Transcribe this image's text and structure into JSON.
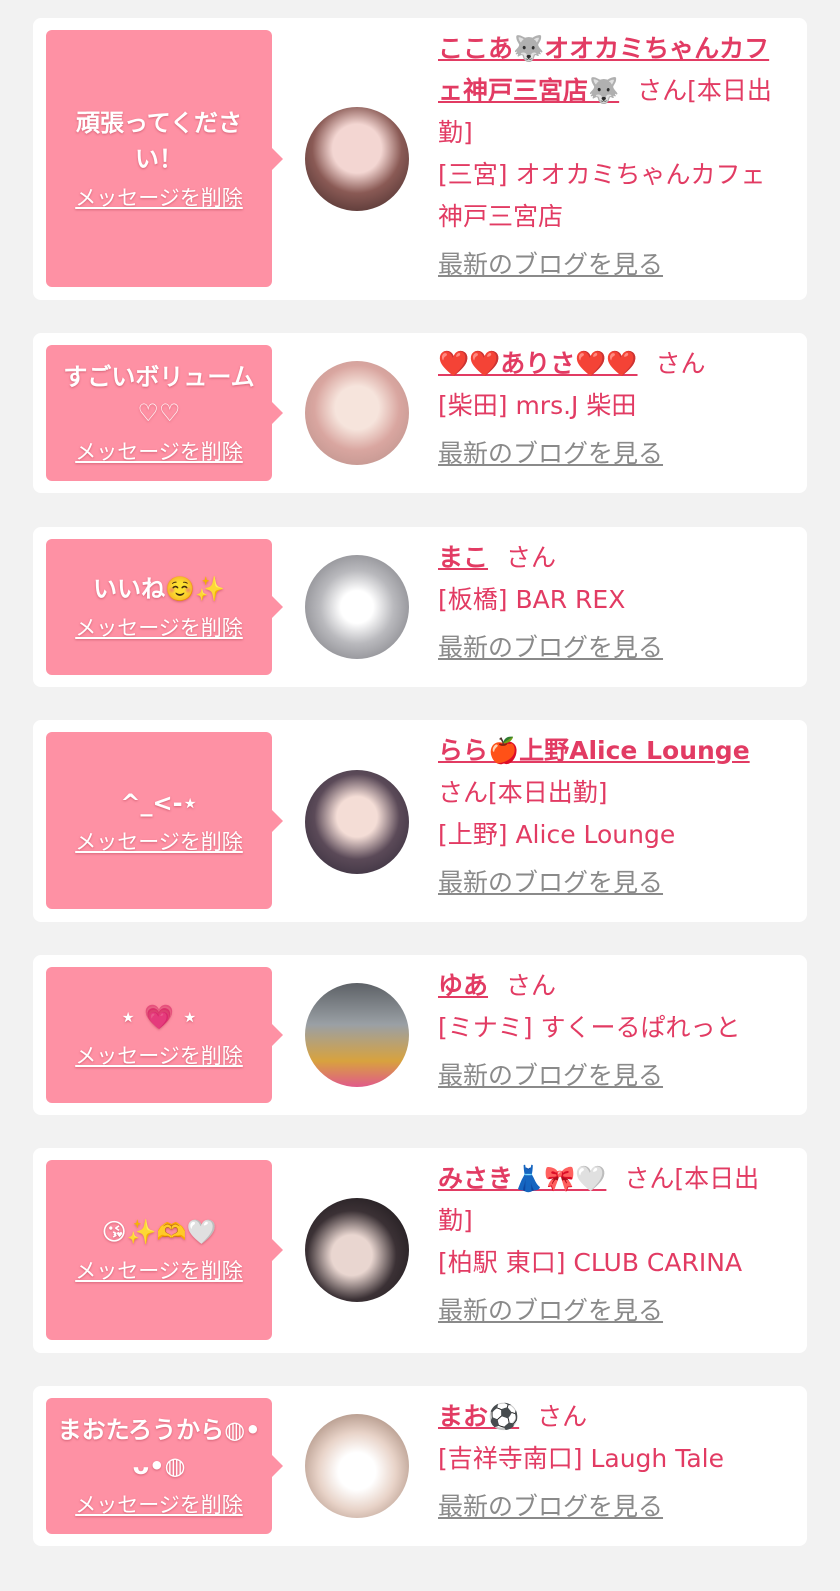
{
  "colors": {
    "bubble": "#fe91a4",
    "accent": "#e23b63",
    "link_gray": "#8a8a8a",
    "background": "#f2f2f2"
  },
  "cards": [
    {
      "message": "頑張ってください！",
      "delete_label": "メッセージを削除",
      "cast_name": "ここあ🐺オオカミちゃんカフェ神戸三宮店🐺",
      "honorific": "さん[本日出勤]",
      "shop": "[三宮] オオカミちゃんカフェ神戸三宮店",
      "blog_link": "最新のブログを見る",
      "avatar_icon": "avatar-photo"
    },
    {
      "message": "すごいボリューム♡♡",
      "delete_label": "メッセージを削除",
      "cast_name": "❤️❤️ありさ❤️❤️",
      "honorific": "さん",
      "shop": "[柴田] mrs.J 柴田",
      "blog_link": "最新のブログを見る",
      "avatar_icon": "avatar-photo"
    },
    {
      "message": "いいね☺️✨",
      "delete_label": "メッセージを削除",
      "cast_name": "まこ",
      "honorific": "さん",
      "shop": "[板橋] BAR REX",
      "blog_link": "最新のブログを見る",
      "avatar_icon": "avatar-photo"
    },
    {
      "message": "^_<-⋆",
      "delete_label": "メッセージを削除",
      "cast_name": "らら🍎上野Alice Lounge",
      "honorific": "さん[本日出勤]",
      "shop": "[上野] Alice Lounge",
      "blog_link": "最新のブログを見る",
      "avatar_icon": "avatar-photo"
    },
    {
      "message": "⋆ 💗 ⋆",
      "delete_label": "メッセージを削除",
      "cast_name": "ゆあ",
      "honorific": "さん",
      "shop": "[ミナミ] すくーるぱれっと",
      "blog_link": "最新のブログを見る",
      "avatar_icon": "avatar-photo"
    },
    {
      "message": "😘✨🫶🤍",
      "delete_label": "メッセージを削除",
      "cast_name": "みさき👗🎀🤍",
      "honorific": "さん[本日出勤]",
      "shop": "[柏駅 東口] CLUB CARINA",
      "blog_link": "最新のブログを見る",
      "avatar_icon": "avatar-photo"
    },
    {
      "message": "まおたろうから◍•ᴗ•◍",
      "delete_label": "メッセージを削除",
      "cast_name": "まお⚽️",
      "honorific": "さん",
      "shop": "[吉祥寺南口] Laugh Tale",
      "blog_link": "最新のブログを見る",
      "avatar_icon": "avatar-photo"
    }
  ]
}
